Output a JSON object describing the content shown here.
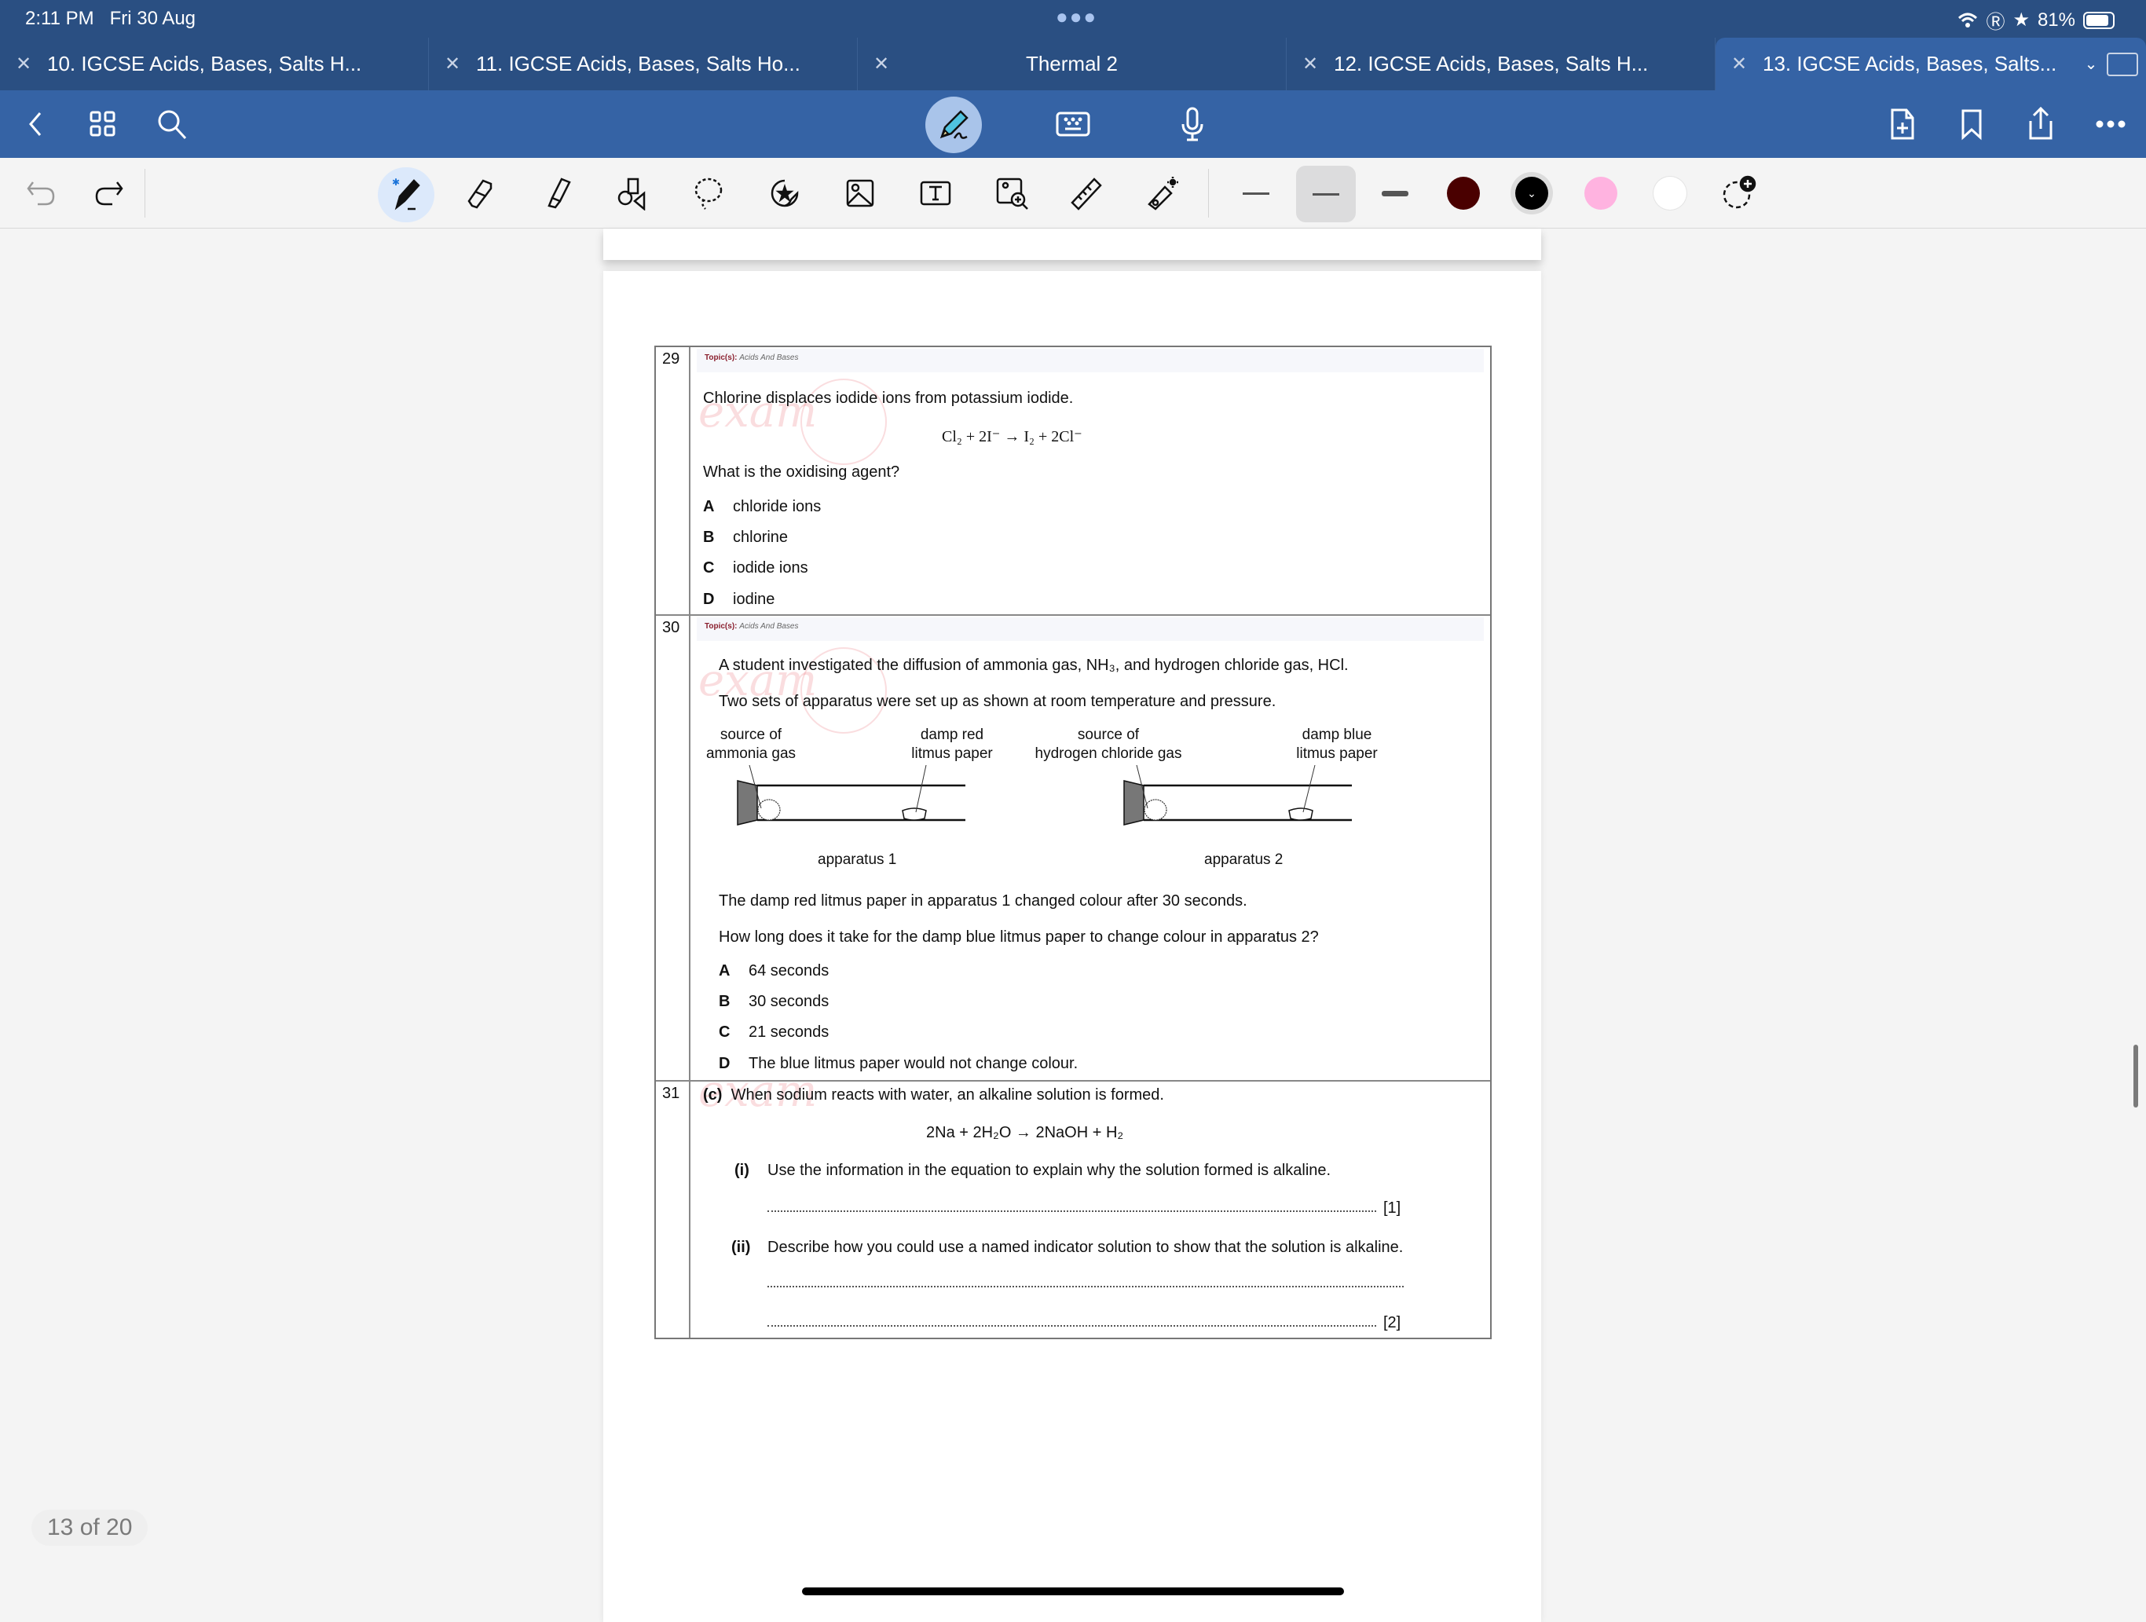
{
  "status_bar": {
    "time": "2:11 PM",
    "date": "Fri 30 Aug",
    "battery": "81%",
    "battery_level": 0.81
  },
  "tabs": [
    {
      "label": "10. IGCSE Acids, Bases, Salts H...",
      "active": false
    },
    {
      "label": "11. IGCSE Acids, Bases, Salts Ho...",
      "active": false
    },
    {
      "label": "Thermal 2",
      "active": false
    },
    {
      "label": "12. IGCSE Acids, Bases, Salts H...",
      "active": false
    },
    {
      "label": "13. IGCSE Acids, Bases, Salts...",
      "active": true
    }
  ],
  "navbar": {
    "left_icons": [
      "back-icon",
      "grid-icon",
      "search-icon"
    ],
    "center_icons": [
      "pen-handwriting-icon",
      "keyboard-icon",
      "microphone-icon"
    ],
    "right_icons": [
      "add-page-icon",
      "bookmark-icon",
      "share-icon",
      "more-icon"
    ]
  },
  "toolbar": {
    "tools": [
      "pen",
      "eraser",
      "highlighter",
      "shapes",
      "lasso",
      "sticker",
      "image",
      "text",
      "image-scan",
      "ruler",
      "laser-pointer"
    ],
    "selected_tool": "pen",
    "thicknesses": [
      "thin",
      "medium",
      "thick"
    ],
    "selected_thickness": "medium",
    "colors": [
      "#4a0000",
      "#000000",
      "#ffb3e0",
      "#ffffff"
    ],
    "selected_color": "#000000"
  },
  "document": {
    "watermark": "exam mAte",
    "questions": [
      {
        "number": "29",
        "topic_label": "Topic(s):",
        "topic": "Acids And Bases",
        "stem": "Chlorine displaces iodide ions from potassium iodide.",
        "equation": "Cl₂ + 2I⁻ → I₂ + 2Cl⁻",
        "prompt": "What is the oxidising agent?",
        "options": [
          {
            "letter": "A",
            "text": "chloride ions"
          },
          {
            "letter": "B",
            "text": "chlorine"
          },
          {
            "letter": "C",
            "text": "iodide ions"
          },
          {
            "letter": "D",
            "text": "iodine"
          }
        ]
      },
      {
        "number": "30",
        "topic_label": "Topic(s):",
        "topic": "Acids And Bases",
        "stem": "A student investigated the diffusion of ammonia gas, NH₃, and hydrogen chloride gas, HCl.",
        "stem2": "Two sets of apparatus were set up as shown at room temperature and pressure.",
        "diagram": {
          "apparatus1": {
            "source_line1": "source of",
            "source_line2": "ammonia gas",
            "paper_line1": "damp red",
            "paper_line2": "litmus paper",
            "caption": "apparatus 1"
          },
          "apparatus2": {
            "source_line1": "source of",
            "source_line2": "hydrogen chloride gas",
            "paper_line1": "damp blue",
            "paper_line2": "litmus paper",
            "caption": "apparatus 2"
          }
        },
        "info": "The damp red litmus paper in apparatus 1 changed colour after 30 seconds.",
        "prompt": "How long does it take for the damp blue litmus paper to change colour in apparatus 2?",
        "options": [
          {
            "letter": "A",
            "text": "64 seconds"
          },
          {
            "letter": "B",
            "text": "30 seconds"
          },
          {
            "letter": "C",
            "text": "21 seconds"
          },
          {
            "letter": "D",
            "text": "The blue litmus paper would not change colour."
          }
        ]
      },
      {
        "number": "31",
        "part": "(c)",
        "stem": "When sodium reacts with water, an alkaline solution is formed.",
        "equation": "2Na + 2H₂O → 2NaOH + H₂",
        "subparts": [
          {
            "label": "(i)",
            "text": "Use the information in the equation to explain why the solution formed is alkaline.",
            "marks": "[1]"
          },
          {
            "label": "(ii)",
            "text": "Describe how you could use a named indicator solution to show that the solution is alkaline.",
            "marks": "[2]"
          }
        ]
      }
    ]
  },
  "page_indicator": "13 of 20"
}
